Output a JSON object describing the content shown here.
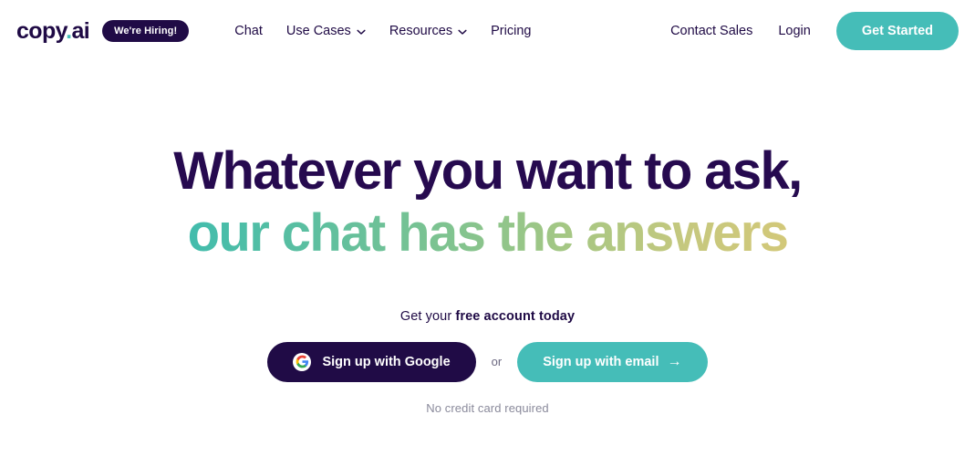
{
  "brand": {
    "logo_main": "copy",
    "logo_dot": ".",
    "logo_suffix": "ai",
    "hiring_badge": "We're Hiring!"
  },
  "colors": {
    "navy": "#200b46",
    "headline_navy": "#260a4f",
    "teal": "#45bdb8",
    "gradient_start": "#3fbcae",
    "gradient_mid": "#7cc391",
    "gradient_end": "#d4c878",
    "muted_gray": "#8a8a9b",
    "or_gray": "#6b6880",
    "page_background": "#ffffff"
  },
  "nav": {
    "links": [
      {
        "label": "Chat",
        "has_chevron": false,
        "icon": ""
      },
      {
        "label": "Use Cases",
        "has_chevron": true,
        "icon": "chevron-down-icon"
      },
      {
        "label": "Resources",
        "has_chevron": true,
        "icon": "chevron-down-icon"
      },
      {
        "label": "Pricing",
        "has_chevron": false,
        "icon": ""
      }
    ],
    "contact_sales": "Contact Sales",
    "login": "Login",
    "get_started": "Get Started"
  },
  "hero": {
    "headline_line1": "Whatever you want to ask,",
    "headline_line2": "our chat has the answers",
    "sub_cta_prefix": "Get your ",
    "sub_cta_bold": "free account today",
    "google_button": "Sign up with Google",
    "google_icon": "google-g-icon",
    "or": "or",
    "email_button": "Sign up with email",
    "email_arrow": "→",
    "fineprint": "No credit card required"
  }
}
